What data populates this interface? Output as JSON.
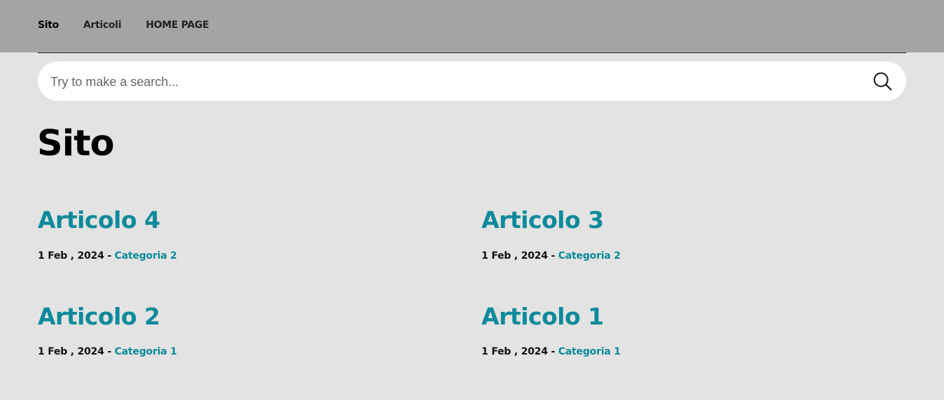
{
  "nav": {
    "items": [
      {
        "label": "Sito"
      },
      {
        "label": "Articoli"
      },
      {
        "label": "HOME PAGE"
      }
    ]
  },
  "search": {
    "placeholder": "Try to make a search...",
    "icon": "search-icon"
  },
  "page": {
    "title": "Sito"
  },
  "articles": [
    {
      "title": "Articolo 4",
      "date": "1 Feb , 2024",
      "separator": " - ",
      "category": "Categoria 2"
    },
    {
      "title": "Articolo 3",
      "date": "1 Feb , 2024",
      "separator": " - ",
      "category": "Categoria 2"
    },
    {
      "title": "Articolo 2",
      "date": "1 Feb , 2024",
      "separator": " - ",
      "category": "Categoria 1"
    },
    {
      "title": "Articolo 1",
      "date": "1 Feb , 2024",
      "separator": " - ",
      "category": "Categoria 1"
    }
  ],
  "colors": {
    "accent": "#0b8a9a",
    "topbar": "#a4a4a4",
    "background": "#e3e3e3"
  }
}
